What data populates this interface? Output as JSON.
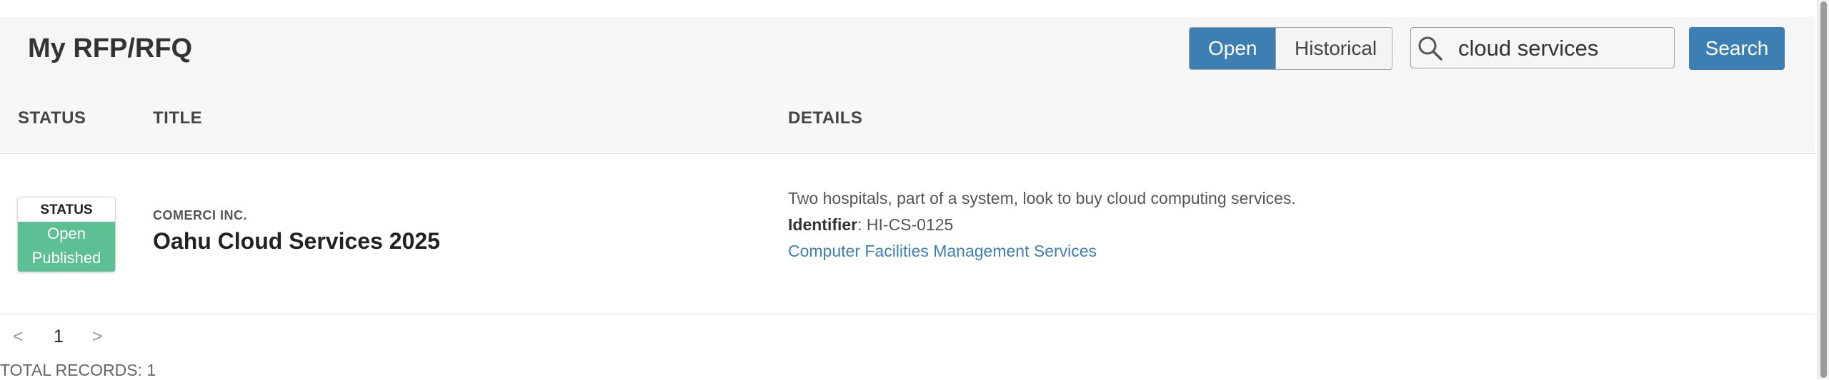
{
  "header": {
    "title": "My RFP/RFQ",
    "toggle": {
      "open_label": "Open",
      "historical_label": "Historical"
    },
    "search": {
      "value": "cloud services",
      "button_label": "Search"
    }
  },
  "columns": {
    "status": "STATUS",
    "title": "TITLE",
    "details": "DETAILS"
  },
  "results": [
    {
      "status_label": "STATUS",
      "status_state": "Open",
      "status_publish": "Published",
      "organization": "COMERCI INC.",
      "title": "Oahu Cloud Services 2025",
      "description": "Two hospitals, part of a system, look to buy cloud computing services.",
      "identifier_label": "Identifier",
      "identifier_value": ": HI-CS-0125",
      "category": "Computer Facilities Management Services"
    }
  ],
  "pager": {
    "prev": "<",
    "current": "1",
    "next": ">"
  },
  "total_records": "TOTAL RECORDS: 1",
  "colors": {
    "accent": "#3e7fb3",
    "status_green": "#5dbf94"
  }
}
